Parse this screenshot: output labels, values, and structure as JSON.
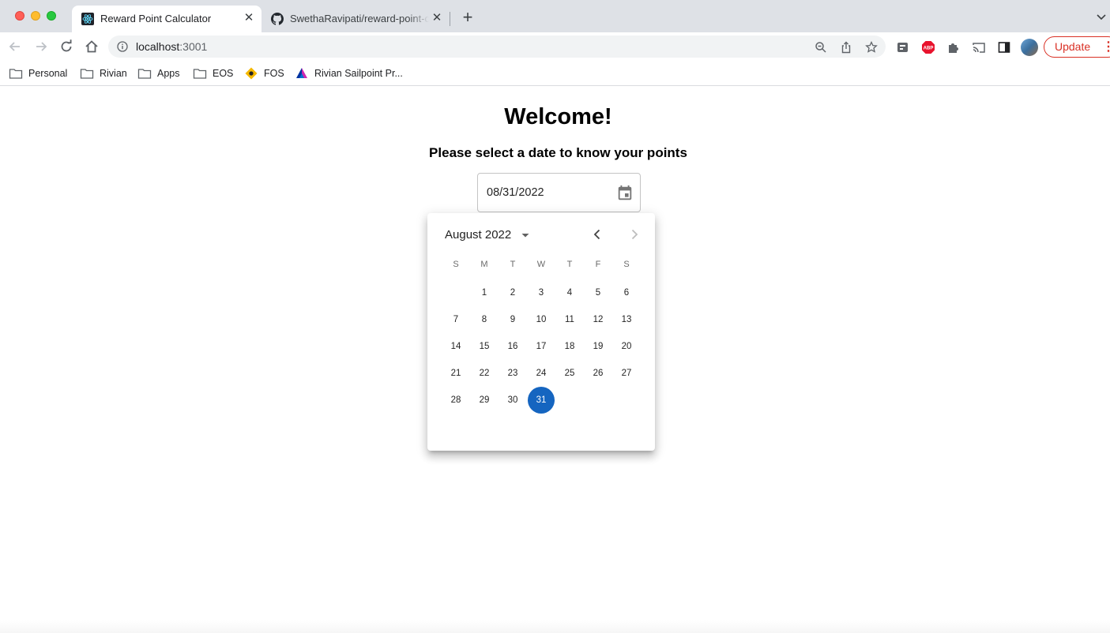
{
  "browser": {
    "tabs": [
      {
        "title": "Reward Point Calculator",
        "active": true,
        "favicon": "react-icon"
      },
      {
        "title": "SwethaRavipati/reward-point-c",
        "active": false,
        "favicon": "github-icon"
      }
    ],
    "url": {
      "host": "localhost",
      "port": ":3001"
    },
    "update_label": "Update",
    "bookmarks": [
      {
        "label": "Personal",
        "icon": "folder-icon"
      },
      {
        "label": "Rivian",
        "icon": "folder-icon"
      },
      {
        "label": "Apps",
        "icon": "folder-icon"
      },
      {
        "label": "EOS",
        "icon": "folder-icon"
      },
      {
        "label": "FOS",
        "icon": "fos-logo-icon"
      },
      {
        "label": "Rivian Sailpoint Pr...",
        "icon": "sailpoint-logo-icon"
      }
    ]
  },
  "page": {
    "heading": "Welcome!",
    "subtitle": "Please select a date to know your points",
    "date_input_value": "08/31/2022"
  },
  "calendar": {
    "month_label": "August 2022",
    "weekdays": [
      "S",
      "M",
      "T",
      "W",
      "T",
      "F",
      "S"
    ],
    "weeks": [
      [
        "",
        "1",
        "2",
        "3",
        "4",
        "5",
        "6"
      ],
      [
        "7",
        "8",
        "9",
        "10",
        "11",
        "12",
        "13"
      ],
      [
        "14",
        "15",
        "16",
        "17",
        "18",
        "19",
        "20"
      ],
      [
        "21",
        "22",
        "23",
        "24",
        "25",
        "26",
        "27"
      ],
      [
        "28",
        "29",
        "30",
        "31",
        "",
        "",
        ""
      ]
    ],
    "selected_day": "31",
    "accent_color": "#1565c0"
  }
}
